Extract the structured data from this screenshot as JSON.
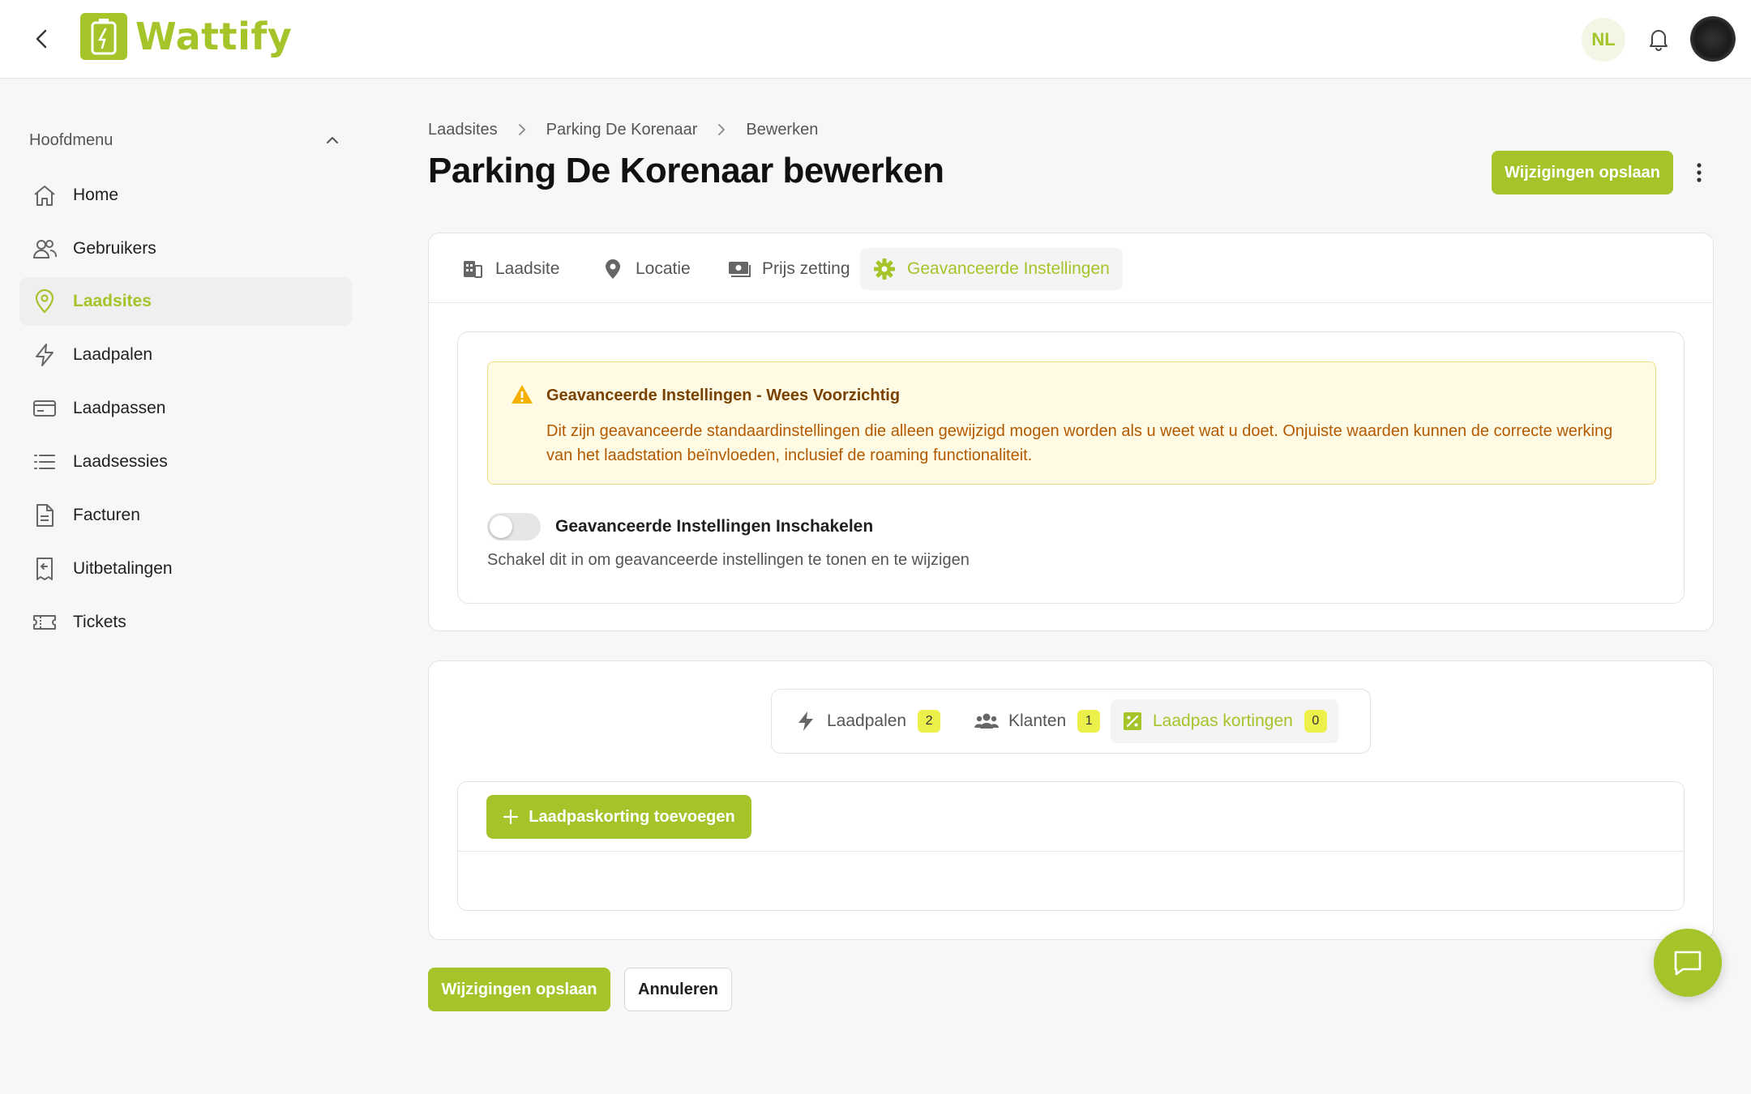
{
  "header": {
    "brand": "Wattify",
    "language": "NL",
    "colors": {
      "accent": "#a5c42a",
      "warning_bg": "#fefae4",
      "warning_text": "#b35a00",
      "badge": "#ecf04a"
    }
  },
  "sidebar": {
    "section_title": "Hoofdmenu",
    "items": [
      {
        "label": "Home",
        "icon": "home-icon"
      },
      {
        "label": "Gebruikers",
        "icon": "users-icon"
      },
      {
        "label": "Laadsites",
        "icon": "map-pin-icon",
        "active": true
      },
      {
        "label": "Laadpalen",
        "icon": "lightning-icon"
      },
      {
        "label": "Laadpassen",
        "icon": "card-icon"
      },
      {
        "label": "Laadsessies",
        "icon": "list-icon"
      },
      {
        "label": "Facturen",
        "icon": "document-icon"
      },
      {
        "label": "Uitbetalingen",
        "icon": "receipt-icon"
      },
      {
        "label": "Tickets",
        "icon": "ticket-icon"
      }
    ]
  },
  "breadcrumb": [
    "Laadsites",
    "Parking De Korenaar",
    "Bewerken"
  ],
  "page": {
    "title": "Parking De Korenaar bewerken",
    "save_label": "Wijzigingen opslaan",
    "cancel_label": "Annuleren"
  },
  "tabs": [
    {
      "label": "Laadsite",
      "icon": "building-icon"
    },
    {
      "label": "Locatie",
      "icon": "location-icon"
    },
    {
      "label": "Prijs zetting",
      "icon": "money-icon"
    },
    {
      "label": "Geavanceerde Instellingen",
      "icon": "gear-icon",
      "active": true
    }
  ],
  "advanced": {
    "warning_title": "Geavanceerde Instellingen - Wees Voorzichtig",
    "warning_text": "Dit zijn geavanceerde standaardinstellingen die alleen gewijzigd mogen worden als u weet wat u doet. Onjuiste waarden kunnen de correcte werking van het laadstation beïnvloeden, inclusief de roaming functionaliteit.",
    "toggle_label": "Geavanceerde Instellingen Inschakelen",
    "toggle_help": "Schakel dit in om geavanceerde instellingen te tonen en te wijzigen",
    "toggle_on": false
  },
  "related_tabs": [
    {
      "label": "Laadpalen",
      "count": "2",
      "icon": "lightning-icon"
    },
    {
      "label": "Klanten",
      "count": "1",
      "icon": "group-icon"
    },
    {
      "label": "Laadpas kortingen",
      "count": "0",
      "icon": "discount-icon",
      "active": true
    }
  ],
  "discounts": {
    "add_label": "Laadpaskorting toevoegen"
  }
}
